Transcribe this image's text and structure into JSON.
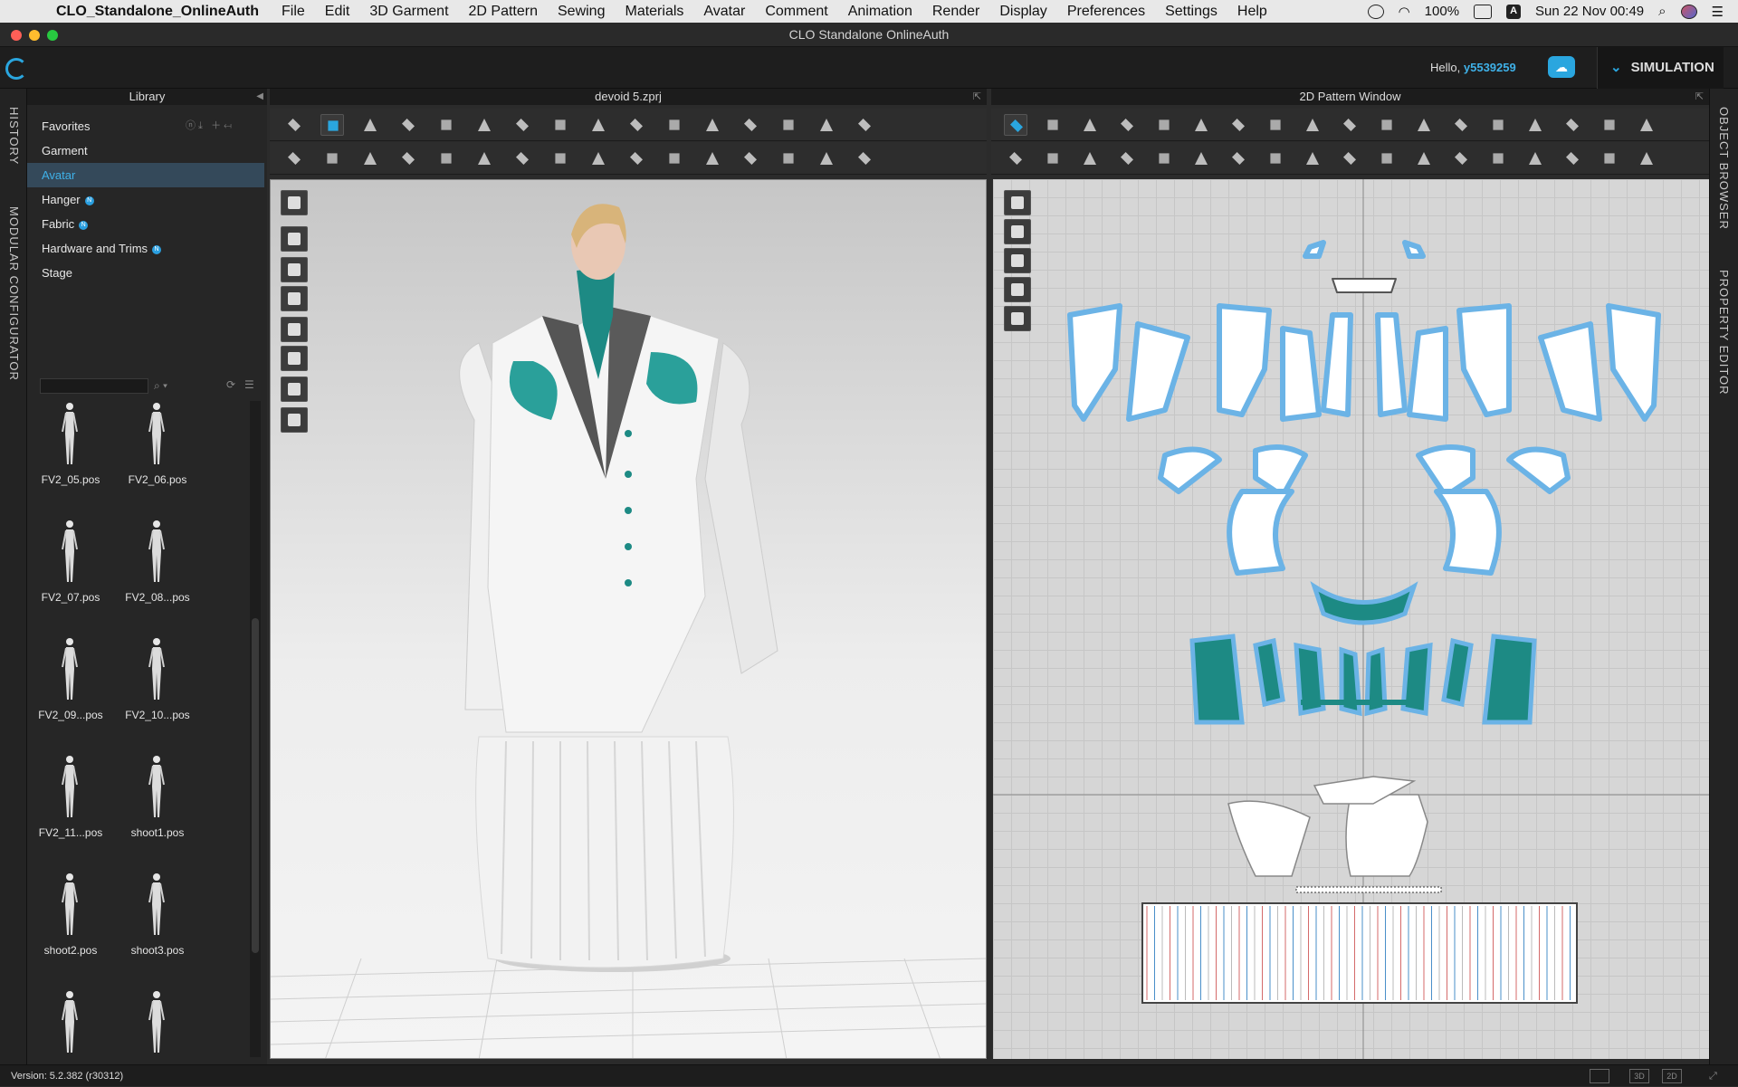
{
  "menubar": {
    "app_name": "CLO_Standalone_OnlineAuth",
    "items": [
      "File",
      "Edit",
      "3D Garment",
      "2D Pattern",
      "Sewing",
      "Materials",
      "Avatar",
      "Comment",
      "Animation",
      "Render",
      "Display",
      "Preferences",
      "Settings",
      "Help"
    ],
    "battery": "100%",
    "input_source": "A",
    "datetime": "Sun 22 Nov  00:49"
  },
  "window": {
    "title": "CLO Standalone OnlineAuth"
  },
  "header": {
    "hello": "Hello,",
    "username": "y5539259",
    "simulation_label": "SIMULATION"
  },
  "side_tabs": {
    "history": "HISTORY",
    "modular": "MODULAR CONFIGURATOR",
    "object_browser": "OBJECT BROWSER",
    "property_editor": "PROPERTY EDITOR"
  },
  "library": {
    "title": "Library",
    "tree": [
      "Favorites",
      "Garment",
      "Avatar",
      "Hanger",
      "Fabric",
      "Hardware and Trims",
      "Stage"
    ],
    "selected": "Avatar",
    "items": [
      "FV2_05.pos",
      "FV2_06.pos",
      "FV2_07.pos",
      "FV2_08...pos",
      "FV2_09...pos",
      "FV2_10...pos",
      "FV2_11...pos",
      "shoot1.pos",
      "shoot2.pos",
      "shoot3.pos"
    ]
  },
  "view3d": {
    "title": "devoid 5.zprj"
  },
  "view2d": {
    "title": "2D Pattern Window"
  },
  "status": {
    "version": "Version: 5.2.382 (r30312)",
    "view_modes": [
      "3D",
      "2D"
    ]
  },
  "colors": {
    "accent": "#2aa6df",
    "teal": "#1d8a84",
    "pattern_outline": "#6bb3e6"
  }
}
